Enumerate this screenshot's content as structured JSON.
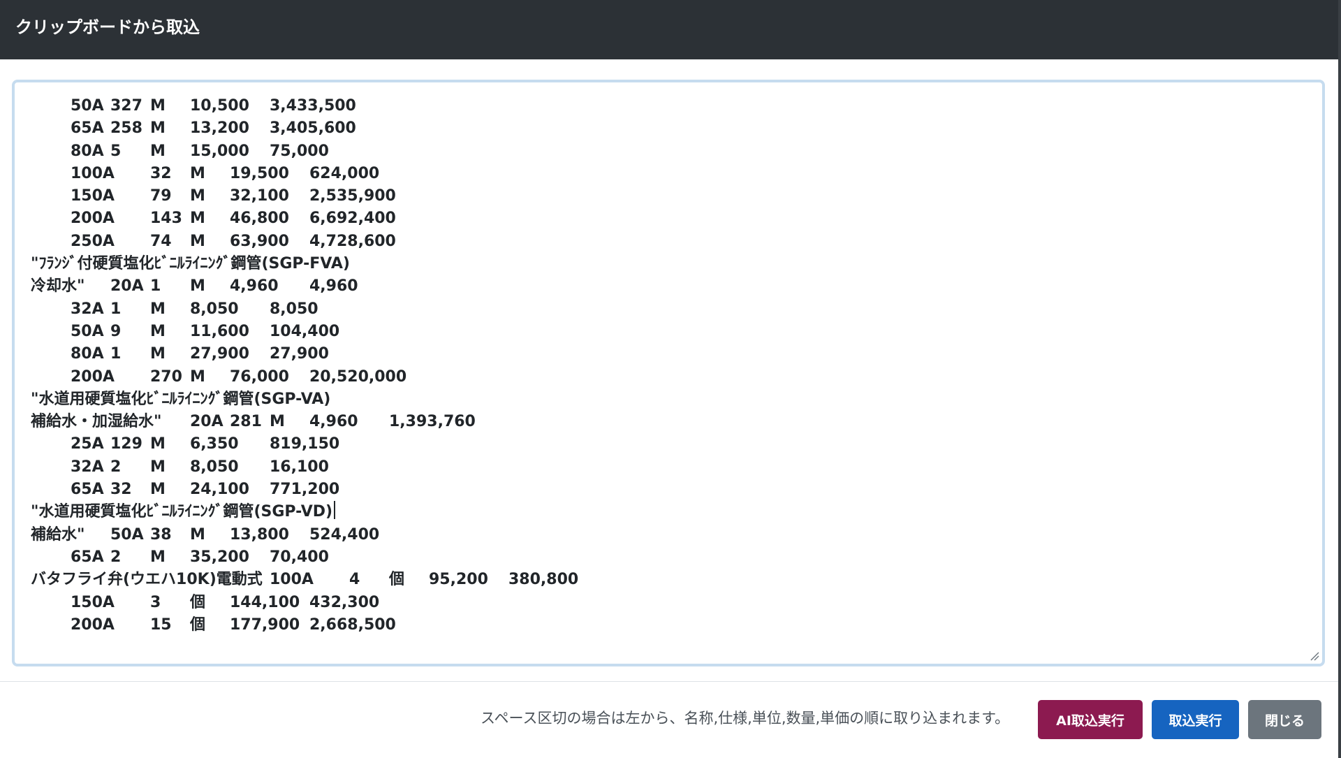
{
  "modal": {
    "title": "クリップボードから取込"
  },
  "textarea": {
    "lines": [
      [
        "",
        "50A",
        "327",
        "M",
        "10,500",
        "3,433,500"
      ],
      [
        "",
        "65A",
        "258",
        "M",
        "13,200",
        "3,405,600"
      ],
      [
        "",
        "80A",
        "5",
        "M",
        "15,000",
        "75,000"
      ],
      [
        "",
        "100A",
        "32",
        "M",
        "19,500",
        "624,000"
      ],
      [
        "",
        "150A",
        "79",
        "M",
        "32,100",
        "2,535,900"
      ],
      [
        "",
        "200A",
        "143",
        "M",
        "46,800",
        "6,692,400"
      ],
      [
        "",
        "250A",
        "74",
        "M",
        "63,900",
        "4,728,600"
      ],
      [
        "\"ﾌﾗﾝｼﾞ付硬質塩化ﾋﾞﾆﾙﾗｲﾆﾝｸﾞ鋼管(SGP-FVA)"
      ],
      [
        "冷却水\"",
        "20A",
        "1",
        "M",
        "4,960",
        "4,960"
      ],
      [
        "",
        "32A",
        "1",
        "M",
        "8,050",
        "8,050"
      ],
      [
        "",
        "50A",
        "9",
        "M",
        "11,600",
        "104,400"
      ],
      [
        "",
        "80A",
        "1",
        "M",
        "27,900",
        "27,900"
      ],
      [
        "",
        "200A",
        "270",
        "M",
        "76,000",
        "20,520,000"
      ],
      [
        "\"水道用硬質塩化ﾋﾞﾆﾙﾗｲﾆﾝｸﾞ鋼管(SGP-VA)"
      ],
      [
        "補給水・加湿給水\"",
        "20A",
        "281",
        "M",
        "4,960",
        "1,393,760"
      ],
      [
        "",
        "25A",
        "129",
        "M",
        "6,350",
        "819,150"
      ],
      [
        "",
        "32A",
        "2",
        "M",
        "8,050",
        "16,100"
      ],
      [
        "",
        "65A",
        "32",
        "M",
        "24,100",
        "771,200"
      ],
      [
        "\"水道用硬質塩化ﾋﾞﾆﾙﾗｲﾆﾝｸﾞ鋼管(SGP-VD)"
      ],
      [
        "補給水\"",
        "50A",
        "38",
        "M",
        "13,800",
        "524,400"
      ],
      [
        "",
        "65A",
        "2",
        "M",
        "35,200",
        "70,400"
      ],
      [
        "バタフライ弁(ウエハ10K)電動式",
        "100A",
        "4",
        "個",
        "95,200",
        "380,800"
      ],
      [
        "",
        "150A",
        "3",
        "個",
        "144,100",
        "432,300"
      ],
      [
        "",
        "200A",
        "15",
        "個",
        "177,900",
        "2,668,500"
      ]
    ]
  },
  "footer": {
    "help_text": "スペース区切の場合は左から、名称,仕様,単位,数量,単価の順に取り込まれます。",
    "ai_import_label": "AI取込実行",
    "import_label": "取込実行",
    "close_label": "閉じる"
  },
  "colors": {
    "header_bg": "#2c3136",
    "ai_button": "#8c1a50",
    "import_button": "#1664c0",
    "close_button": "#6c757d",
    "focus_ring": "#c6dcef"
  }
}
